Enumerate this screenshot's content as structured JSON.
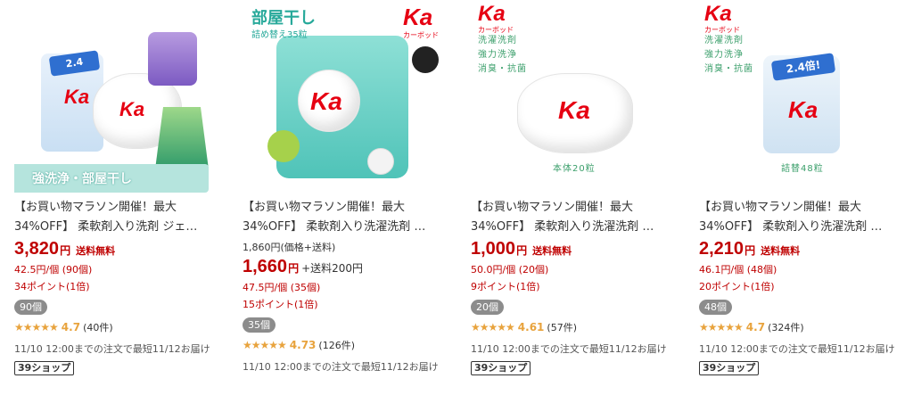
{
  "colors": {
    "price": "#bf0000",
    "star": "#e8a33d",
    "badge": "#8c8c8c",
    "brand": "#e60012",
    "teal": "#4fc3b8"
  },
  "products": [
    {
      "image": {
        "banner": "強洗浄・部屋干し"
      },
      "title_line1": "【お買い物マラソン開催！最大",
      "title_line2": "34%OFF】 柔軟剤入り洗剤 ジェ…",
      "price": "3,820",
      "yen": "円",
      "shipping": "送料無料",
      "unit_price": "42.5円/個 (90個)",
      "points": "34ポイント(1倍)",
      "qty_badge": "90個",
      "stars": "★★★★★",
      "rating": "4.7",
      "review_count": "(40件)",
      "delivery": "11/10 12:00までの注文で最短11/12お届け",
      "shop": "39ショップ"
    },
    {
      "image": {
        "headline": "部屋干し",
        "sub": "詰め替え35粒",
        "brand_text": "Ka",
        "brand_sub": "カーボッド"
      },
      "title_line1": "【お買い物マラソン開催！最大",
      "title_line2": "34%OFF】 柔軟剤入り洗濯洗剤 …",
      "ref_price": "1,860円(価格+送料)",
      "price": "1,660",
      "yen": "円",
      "shipping": "+送料200円",
      "unit_price": "47.5円/個 (35個)",
      "points": "15ポイント(1倍)",
      "qty_badge": "35個",
      "stars": "★★★★★",
      "rating": "4.73",
      "review_count": "(126件)",
      "delivery": "11/10 12:00までの注文で最短11/12お届け",
      "shop": "39ショップ"
    },
    {
      "image": {
        "brand_text": "Ka",
        "brand_sub": "カーボッド",
        "features": [
          "洗濯洗剤",
          "強力洗浄",
          "消臭・抗菌"
        ],
        "caption": "本体20粒"
      },
      "title_line1": "【お買い物マラソン開催！最大",
      "title_line2": "34%OFF】 柔軟剤入り洗濯洗剤 …",
      "price": "1,000",
      "yen": "円",
      "shipping": "送料無料",
      "unit_price": "50.0円/個 (20個)",
      "points": "9ポイント(1倍)",
      "qty_badge": "20個",
      "stars": "★★★★★",
      "rating": "4.61",
      "review_count": "(57件)",
      "delivery": "11/10 12:00までの注文で最短11/12お届け",
      "shop": "39ショップ"
    },
    {
      "image": {
        "brand_text": "Ka",
        "brand_sub": "カーボッド",
        "features": [
          "洗濯洗剤",
          "強力洗浄",
          "消臭・抗菌"
        ],
        "caption": "詰替48粒",
        "pack_badge": "2.4倍!"
      },
      "title_line1": "【お買い物マラソン開催！最大",
      "title_line2": "34%OFF】 柔軟剤入り洗濯洗剤 …",
      "price": "2,210",
      "yen": "円",
      "shipping": "送料無料",
      "unit_price": "46.1円/個 (48個)",
      "points": "20ポイント(1倍)",
      "qty_badge": "48個",
      "stars": "★★★★★",
      "rating": "4.7",
      "review_count": "(324件)",
      "delivery": "11/10 12:00までの注文で最短11/12お届け",
      "shop": "39ショップ"
    }
  ]
}
